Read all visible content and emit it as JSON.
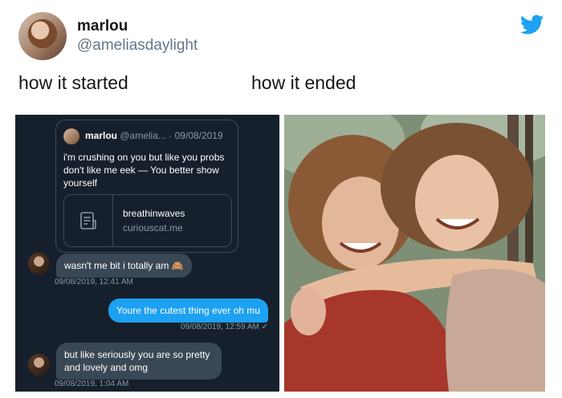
{
  "tweet": {
    "display_name": "marlou",
    "handle": "@ameliasdaylight",
    "caption_left": "how it started",
    "caption_right": "how it ended"
  },
  "chat": {
    "quoted": {
      "name": "marlou",
      "handle": "@amelia...",
      "date": "09/08/2019",
      "text": "i'm crushing on you but like you probs don't like me eek — You better show yourself",
      "card_title": "breathinwaves",
      "card_url": "curiouscat.me"
    },
    "messages": [
      {
        "direction": "in",
        "text": "wasn't me bit i totally am 🙈",
        "time": "09/08/2019, 12:41 AM"
      },
      {
        "direction": "out",
        "text": "Youre the cutest thing ever oh mu",
        "time": "09/08/2019, 12:59 AM ✓"
      },
      {
        "direction": "in",
        "text": "but like seriously you are so pretty and lovely and omg",
        "time": "09/08/2019, 1:04 AM"
      }
    ]
  },
  "colors": {
    "twitter_blue": "#1da1f2",
    "chat_bg": "#16202c",
    "incoming_bubble": "#3a4754"
  },
  "icons": [
    "twitter-bird-icon",
    "document-icon"
  ]
}
